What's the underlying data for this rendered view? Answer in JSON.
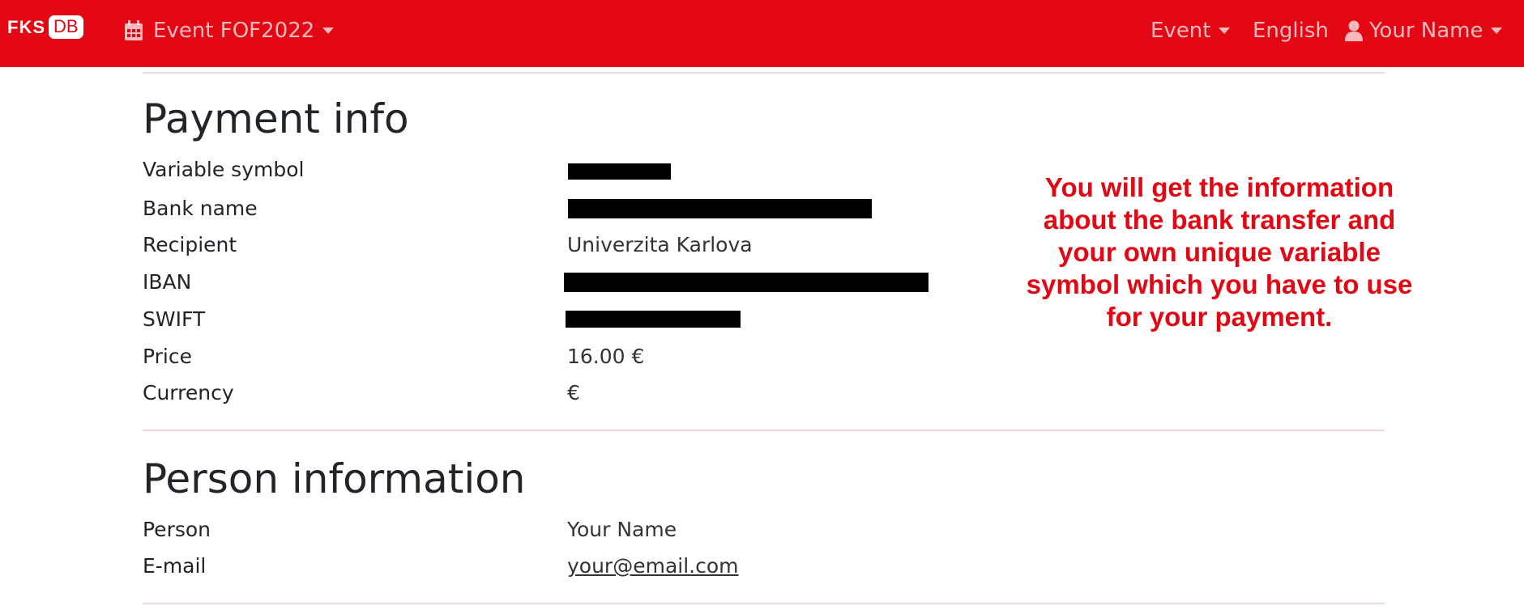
{
  "navbar": {
    "brand_left": "FKS",
    "brand_right": "DB",
    "event_selector": "Event FOF2022",
    "event_menu": "Event",
    "language": "English",
    "user": "Your Name"
  },
  "payment": {
    "title": "Payment info",
    "rows": [
      {
        "label": "Variable symbol",
        "value": ""
      },
      {
        "label": "Bank name",
        "value": ""
      },
      {
        "label": "Recipient",
        "value": "Univerzita Karlova"
      },
      {
        "label": "IBAN",
        "value": ""
      },
      {
        "label": "SWIFT",
        "value": ""
      },
      {
        "label": "Price",
        "value": "16.00 €"
      },
      {
        "label": "Currency",
        "value": "€"
      }
    ]
  },
  "annotation": {
    "lines": [
      "You will get the information",
      "about the bank transfer and",
      "your own unique variable",
      "symbol which you have to use",
      "for your payment."
    ],
    "color": "#e30613"
  },
  "person": {
    "title": "Person information",
    "rows": [
      {
        "label": "Person",
        "value": "Your Name"
      },
      {
        "label": "E-mail",
        "value": "your@email.com"
      }
    ]
  },
  "colors": {
    "navbar": "#e30613",
    "divider": "#f1d7da",
    "link": "#2a7cc7"
  }
}
